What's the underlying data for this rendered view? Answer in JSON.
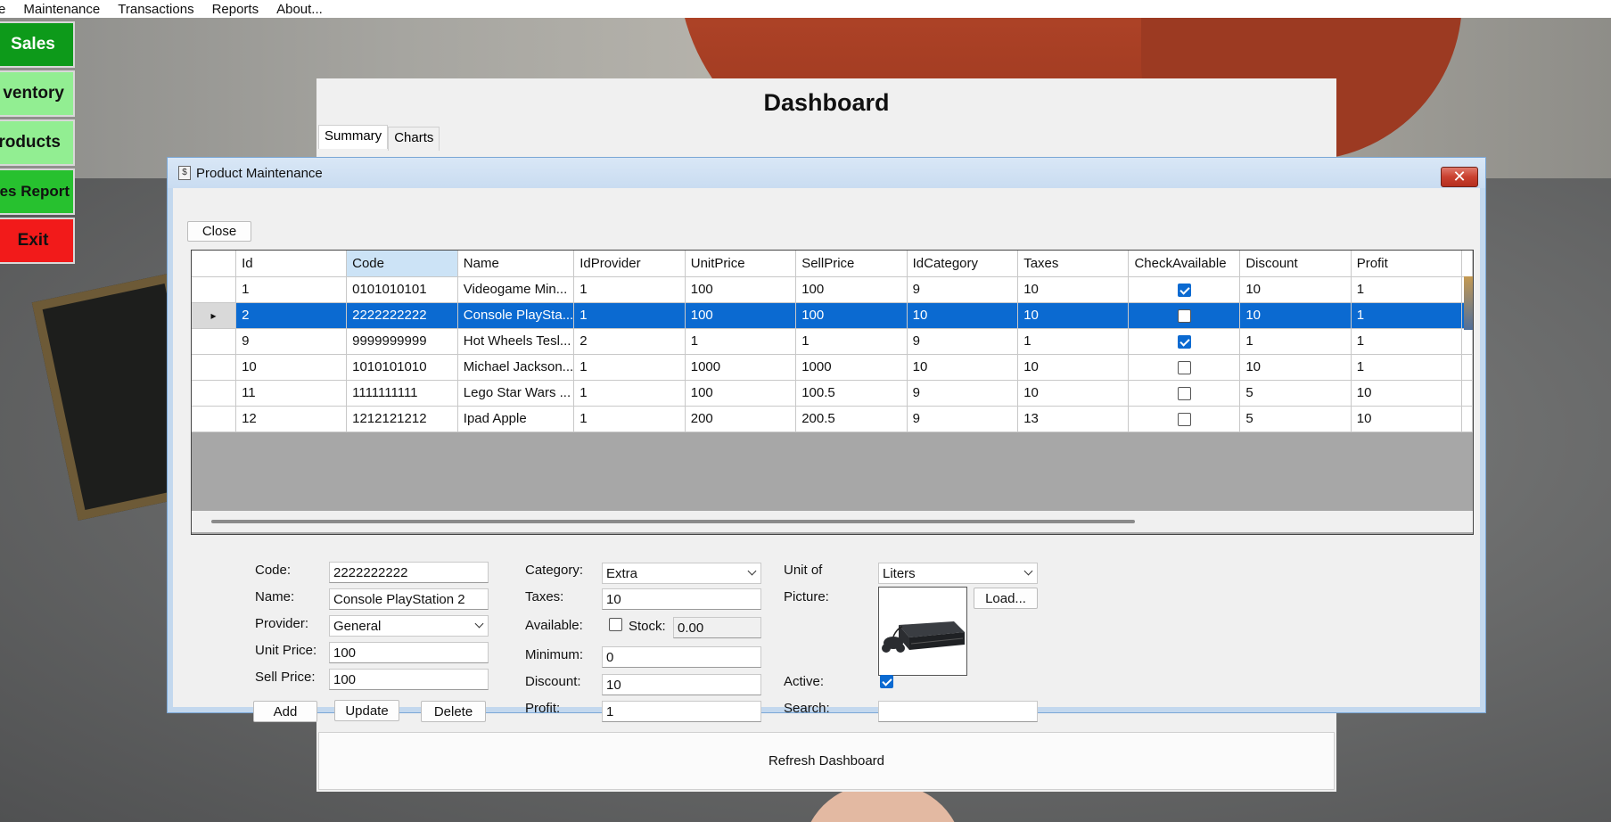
{
  "menu": {
    "items": [
      "e",
      "Maintenance",
      "Transactions",
      "Reports",
      "About..."
    ]
  },
  "sidebar": {
    "sales": "Sales",
    "inventory": "ventory",
    "products": "roducts",
    "report": "es Report",
    "exit": "Exit"
  },
  "dashboard": {
    "title": "Dashboard",
    "tabs": [
      "Summary",
      "Charts"
    ],
    "refresh_label": "Refresh Dashboard"
  },
  "product_window": {
    "title": "Product Maintenance",
    "close_glyph": "✕",
    "close_button": "Close",
    "grid": {
      "columns": [
        "Id",
        "Code",
        "Name",
        "IdProvider",
        "UnitPrice",
        "SellPrice",
        "IdCategory",
        "Taxes",
        "CheckAvailable",
        "Discount",
        "Profit"
      ],
      "selected_column": "Code",
      "rows": [
        {
          "id": "1",
          "code": "0101010101",
          "name": "Videogame Min...",
          "idprovider": "1",
          "unitprice": "100",
          "sellprice": "100",
          "idcategory": "9",
          "taxes": "10",
          "available": true,
          "discount": "10",
          "profit": "1"
        },
        {
          "id": "2",
          "code": "2222222222",
          "name": "Console PlaySta...",
          "idprovider": "1",
          "unitprice": "100",
          "sellprice": "100",
          "idcategory": "10",
          "taxes": "10",
          "available": false,
          "discount": "10",
          "profit": "1"
        },
        {
          "id": "9",
          "code": "9999999999",
          "name": "Hot Wheels Tesl...",
          "idprovider": "2",
          "unitprice": "1",
          "sellprice": "1",
          "idcategory": "9",
          "taxes": "1",
          "available": true,
          "discount": "1",
          "profit": "1"
        },
        {
          "id": "10",
          "code": "1010101010",
          "name": "Michael Jackson...",
          "idprovider": "1",
          "unitprice": "1000",
          "sellprice": "1000",
          "idcategory": "10",
          "taxes": "10",
          "available": false,
          "discount": "10",
          "profit": "1"
        },
        {
          "id": "11",
          "code": "1111111111",
          "name": "Lego Star Wars ...",
          "idprovider": "1",
          "unitprice": "100",
          "sellprice": "100.5",
          "idcategory": "9",
          "taxes": "10",
          "available": false,
          "discount": "5",
          "profit": "10"
        },
        {
          "id": "12",
          "code": "1212121212",
          "name": "Ipad Apple",
          "idprovider": "1",
          "unitprice": "200",
          "sellprice": "200.5",
          "idcategory": "9",
          "taxes": "13",
          "available": false,
          "discount": "5",
          "profit": "10"
        }
      ],
      "selected_row_index": 1,
      "current_row_marker": "▸"
    },
    "form": {
      "code_label": "Code:",
      "code_value": "2222222222",
      "name_label": "Name:",
      "name_value": "Console PlayStation 2",
      "provider_label": "Provider:",
      "provider_value": "General",
      "unitprice_label": "Unit Price:",
      "unitprice_value": "100",
      "sellprice_label": "Sell Price:",
      "sellprice_value": "100",
      "add_label": "Add",
      "update_label": "Update",
      "delete_label": "Delete",
      "category_label": "Category:",
      "category_value": "Extra",
      "taxes_label": "Taxes:",
      "taxes_value": "10",
      "available_label": "Available:",
      "available_checked": false,
      "stock_label": "Stock:",
      "stock_value": "0.00",
      "minimum_label": "Minimum:",
      "minimum_value": "0",
      "discount_label": "Discount:",
      "discount_value": "10",
      "profit_label": "Profit:",
      "profit_value": "1",
      "unit_label": "Unit of",
      "unit_value": "Liters",
      "picture_label": "Picture:",
      "load_label": "Load...",
      "active_label": "Active:",
      "active_checked": true,
      "search_label": "Search:",
      "search_value": ""
    }
  }
}
